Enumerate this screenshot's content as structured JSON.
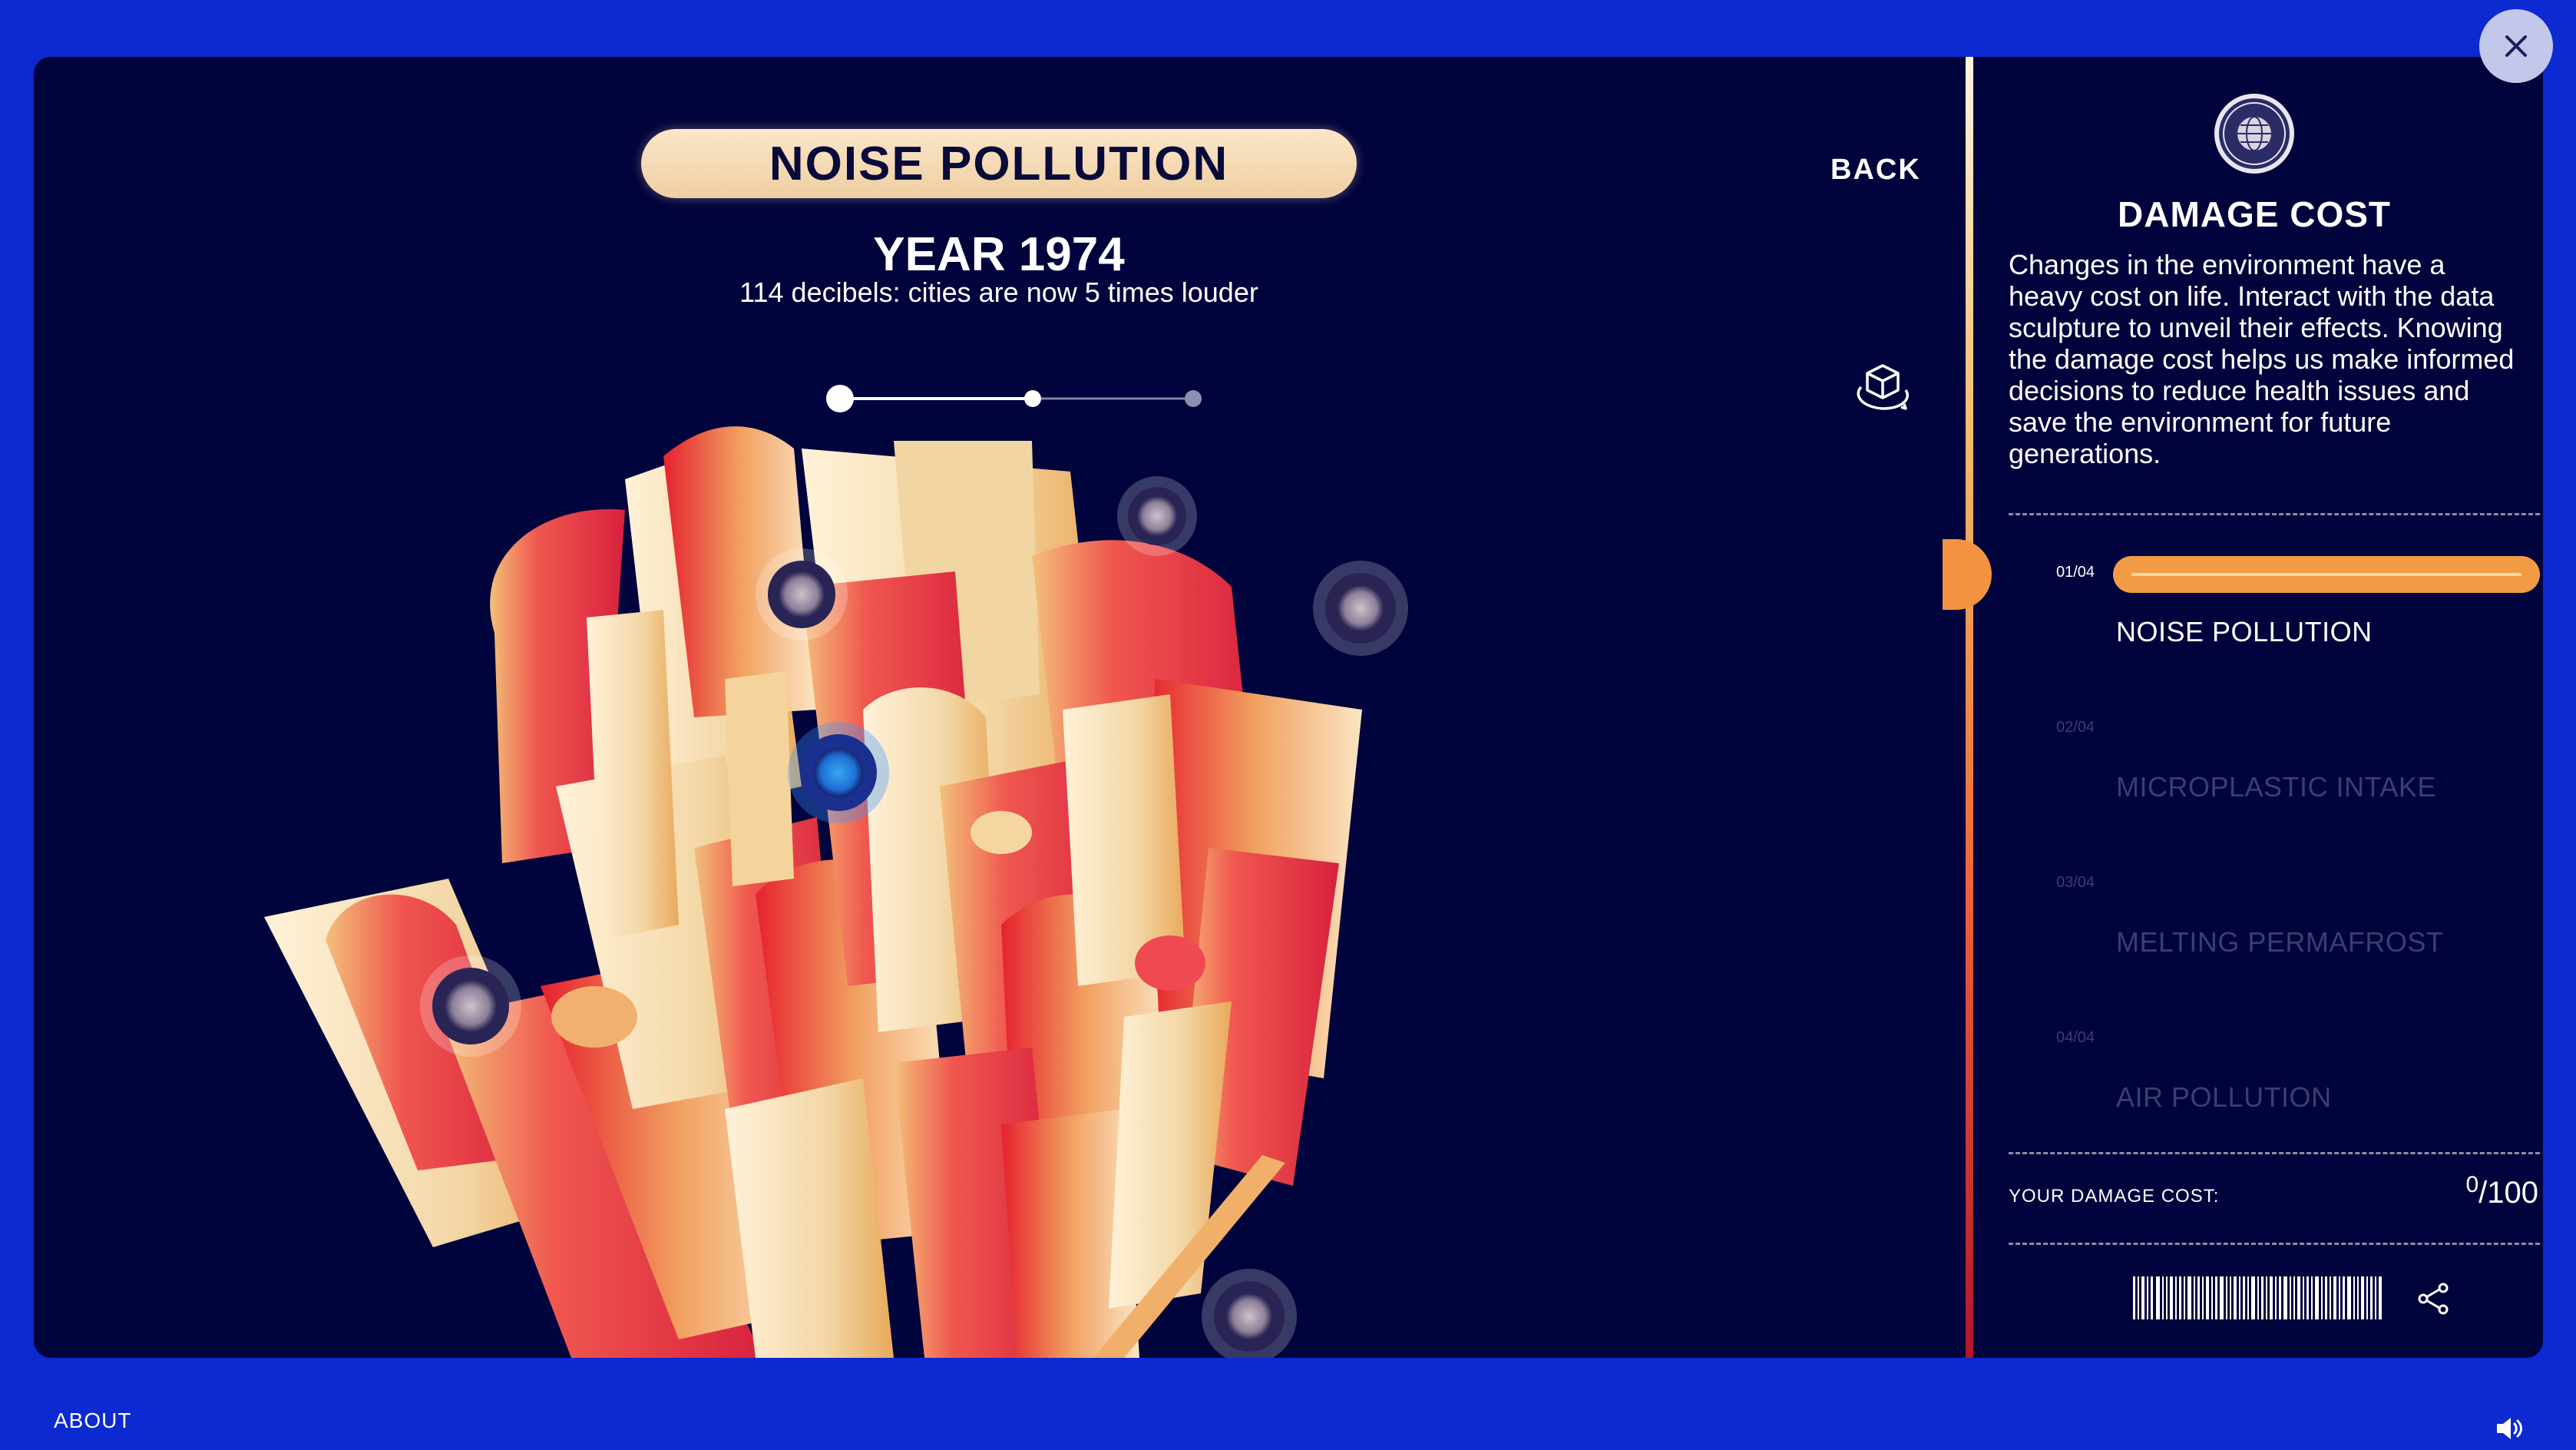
{
  "window": {
    "close_label": "×"
  },
  "main": {
    "title": "NOISE POLLUTION",
    "year": "YEAR 1974",
    "caption": "114 decibels: cities are now 5 times louder",
    "back_label": "BACK",
    "timeline": {
      "position": 0,
      "steps": 3
    }
  },
  "sidebar": {
    "title": "DAMAGE COST",
    "description": "Changes in the environment have a heavy cost on life. Interact with the data sculpture to unveil their effects. Knowing the damage cost helps us make informed decisions to reduce health issues and save the environment for future generations.",
    "steps": [
      {
        "num": "01",
        "total": "/04",
        "label": "NOISE POLLUTION",
        "active": true
      },
      {
        "num": "02",
        "total": "/04",
        "label": "MICROPLASTIC INTAKE",
        "active": false
      },
      {
        "num": "03",
        "total": "/04",
        "label": "MELTING PERMAFROST",
        "active": false
      },
      {
        "num": "04",
        "total": "/04",
        "label": "AIR POLLUTION",
        "active": false
      }
    ],
    "damage_cost_label": "YOUR DAMAGE COST:",
    "damage_cost_value": "0",
    "damage_cost_max": "/100"
  },
  "footer": {
    "about_label": "ABOUT"
  },
  "icons": {
    "close": "close-icon",
    "cube": "3d-cube-rotate-icon",
    "badge": "globe-badge-icon",
    "share": "share-icon",
    "sound": "speaker-icon",
    "hotspot": "globe-hotspot-icon"
  },
  "colors": {
    "background": "#0d29d0",
    "panel": "#01033c",
    "accent": "#f29b45",
    "pill": "#f5dcb6"
  }
}
